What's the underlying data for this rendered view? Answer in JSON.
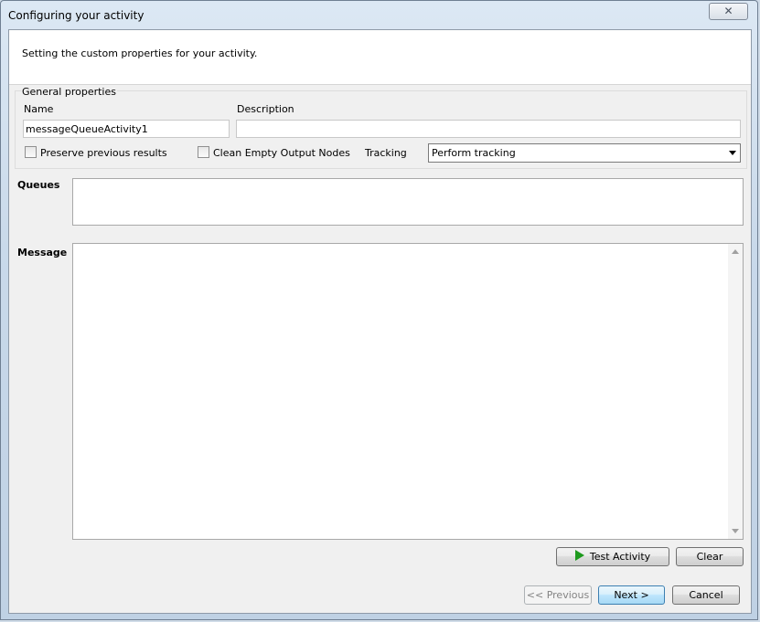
{
  "window": {
    "title": "Configuring your activity",
    "close_glyph": "✕"
  },
  "header": {
    "text": "Setting the custom properties for your activity."
  },
  "general": {
    "title": "General properties",
    "name_label": "Name",
    "name_value": "messageQueueActivity1",
    "description_label": "Description",
    "description_value": "",
    "preserve_label": "Preserve previous results",
    "preserve_checked": false,
    "clean_label": "Clean Empty Output Nodes",
    "clean_checked": false,
    "tracking_label": "Tracking",
    "tracking_value": "Perform tracking"
  },
  "queues": {
    "label": "Queues",
    "value": ""
  },
  "message": {
    "label": "Message",
    "value": ""
  },
  "buttons": {
    "test_activity": "Test Activity",
    "clear": "Clear",
    "previous": "<< Previous",
    "next": "Next >",
    "cancel": "Cancel"
  }
}
